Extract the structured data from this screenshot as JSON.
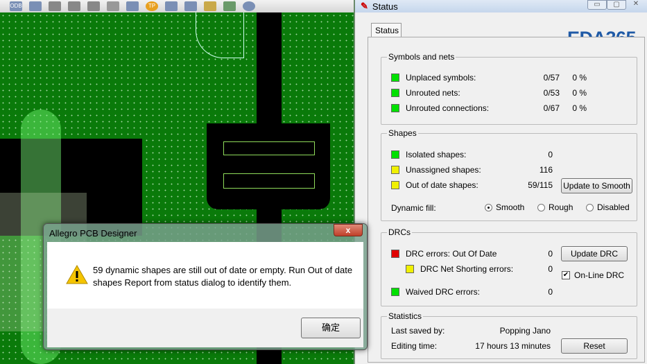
{
  "toolbar": {
    "icons": [
      "odb-icon",
      "layers-icon",
      "wrench-icon",
      "camera-icon",
      "v1v2-icon",
      "pin-icon",
      "grid-icon",
      "testpoint-icon",
      "components-icon",
      "route-icon",
      "notes-icon",
      "monitor-icon",
      "help-icon"
    ],
    "odb": "ODB",
    "tp": "TP"
  },
  "status": {
    "title": "Status",
    "tab": "Status",
    "logo": "EDA365",
    "symbols": {
      "title": "Symbols and nets",
      "rows": [
        {
          "label": "Unplaced symbols:",
          "value": "0/57",
          "pct": "0 %",
          "color": "#00e000"
        },
        {
          "label": "Unrouted nets:",
          "value": "0/53",
          "pct": "0 %",
          "color": "#00e000"
        },
        {
          "label": "Unrouted connections:",
          "value": "0/67",
          "pct": "0 %",
          "color": "#00e000"
        }
      ]
    },
    "shapes": {
      "title": "Shapes",
      "rows": [
        {
          "label": "Isolated shapes:",
          "value": "0",
          "color": "#00e000"
        },
        {
          "label": "Unassigned shapes:",
          "value": "116",
          "color": "#f0f000"
        },
        {
          "label": "Out of date shapes:",
          "value": "59/115",
          "color": "#f0f000"
        }
      ],
      "update_button": "Update to Smooth",
      "fill_label": "Dynamic fill:",
      "fill_options": [
        "Smooth",
        "Rough",
        "Disabled"
      ],
      "fill_selected": "Smooth"
    },
    "drcs": {
      "title": "DRCs",
      "errors_label": "DRC errors:",
      "errors_status": "Out Of Date",
      "errors_value": "0",
      "errors_color": "#e00000",
      "shorting_label": "DRC Net Shorting errors:",
      "shorting_value": "0",
      "shorting_color": "#f0f000",
      "waived_label": "Waived DRC errors:",
      "waived_value": "0",
      "waived_color": "#00e000",
      "update_button": "Update DRC",
      "online_label": "On-Line DRC",
      "online_checked": true
    },
    "stats": {
      "title": "Statistics",
      "saved_label": "Last saved by:",
      "saved_value": "Popping Jano",
      "time_label": "Editing time:",
      "time_value": "17 hours 13 minutes",
      "reset_button": "Reset"
    }
  },
  "dialog": {
    "title": "Allegro PCB Designer",
    "message": "59 dynamic shapes are still out of date or empty. Run Out of date shapes Report from status dialog to identify them.",
    "ok": "确定",
    "close": "x"
  }
}
